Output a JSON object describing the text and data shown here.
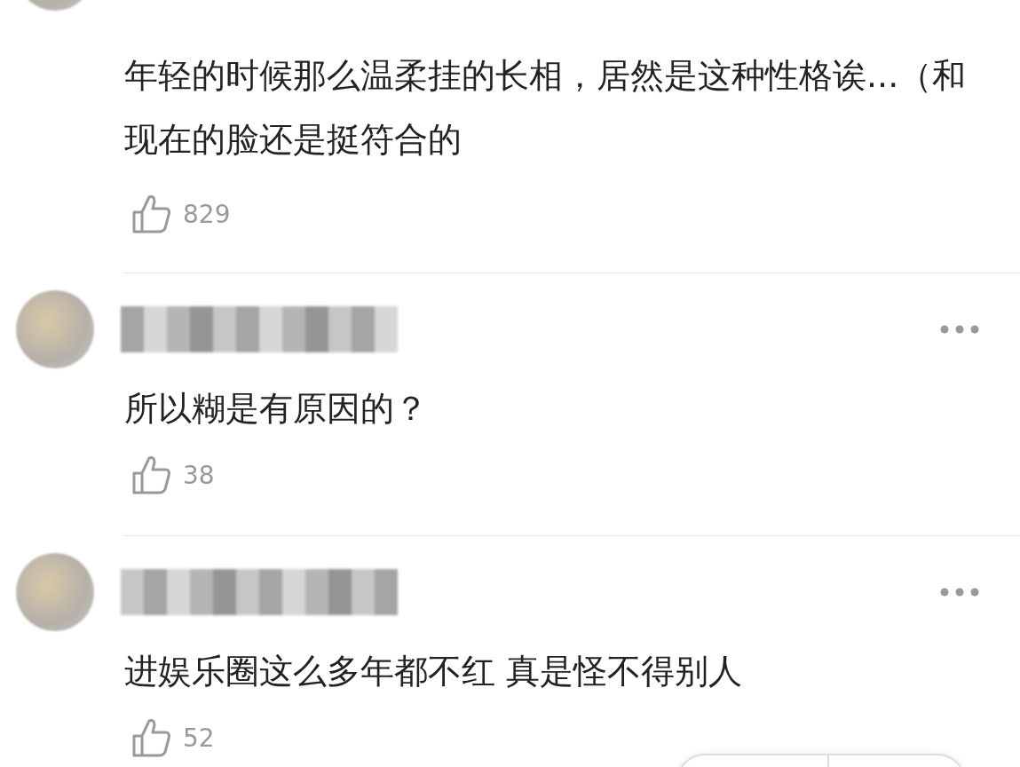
{
  "comments": [
    {
      "text": "年轻的时候那么温柔挂的长相，居然是这种性格诶...（和现在的脸还是挺符合的",
      "likes": "829"
    },
    {
      "text": "所以糊是有原因的？",
      "likes": "38"
    },
    {
      "text": "进娱乐圈这么多年都不红 真是怪不得别人",
      "likes": "52"
    }
  ]
}
